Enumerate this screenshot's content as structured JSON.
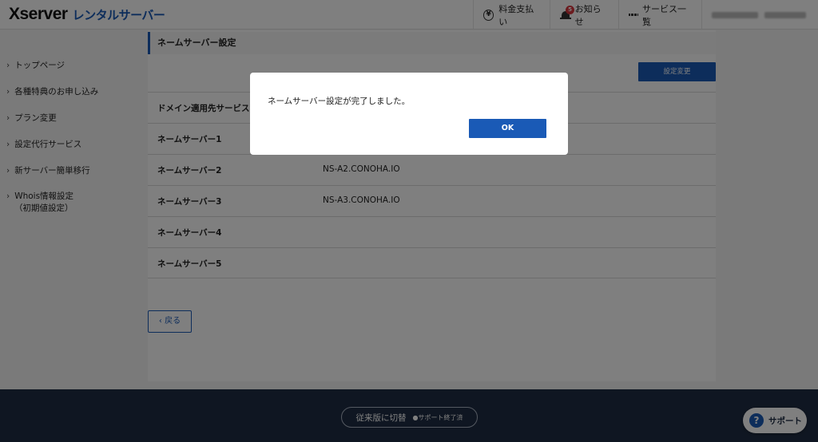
{
  "header": {
    "logo_main": "Xserver",
    "logo_sub": "レンタルサーバー",
    "billing": "料金支払い",
    "notice": "お知らせ",
    "notice_count": "5",
    "services": "サービス一覧",
    "icons": {
      "billing": "yen-icon",
      "notice": "bell-icon",
      "services": "grid-icon"
    }
  },
  "sidebar": {
    "items": [
      {
        "label": "トップページ"
      },
      {
        "label": "各種特典のお申し込み"
      },
      {
        "label": "プラン変更"
      },
      {
        "label": "設定代行サービス"
      },
      {
        "label": "新サーバー簡単移行"
      },
      {
        "label": "Whois情報設定"
      }
    ],
    "item_6_sub": "（初期値設定）",
    "chevron": "›"
  },
  "main": {
    "title": "ネームサーバー設定",
    "edit_button": "設定変更",
    "rows": [
      {
        "label": "ドメイン適用先サービス",
        "value": ""
      },
      {
        "label": "ネームサーバー1",
        "value": ""
      },
      {
        "label": "ネームサーバー2",
        "value": "NS-A2.CONOHA.IO"
      },
      {
        "label": "ネームサーバー3",
        "value": "NS-A3.CONOHA.IO"
      },
      {
        "label": "ネームサーバー4",
        "value": ""
      },
      {
        "label": "ネームサーバー5",
        "value": ""
      }
    ],
    "back_button": "‹ 戻る"
  },
  "footer": {
    "legacy_button": "従来版に切替",
    "legacy_note": "●サポート終了済",
    "support_button": "サポート",
    "support_icon_glyph": "?"
  },
  "modal": {
    "message": "ネームサーバー設定が完了しました。",
    "ok_button": "OK"
  },
  "colors": {
    "accent": "#1a5ab6",
    "footer_bg": "#1f2d44",
    "badge": "#d9363e"
  }
}
